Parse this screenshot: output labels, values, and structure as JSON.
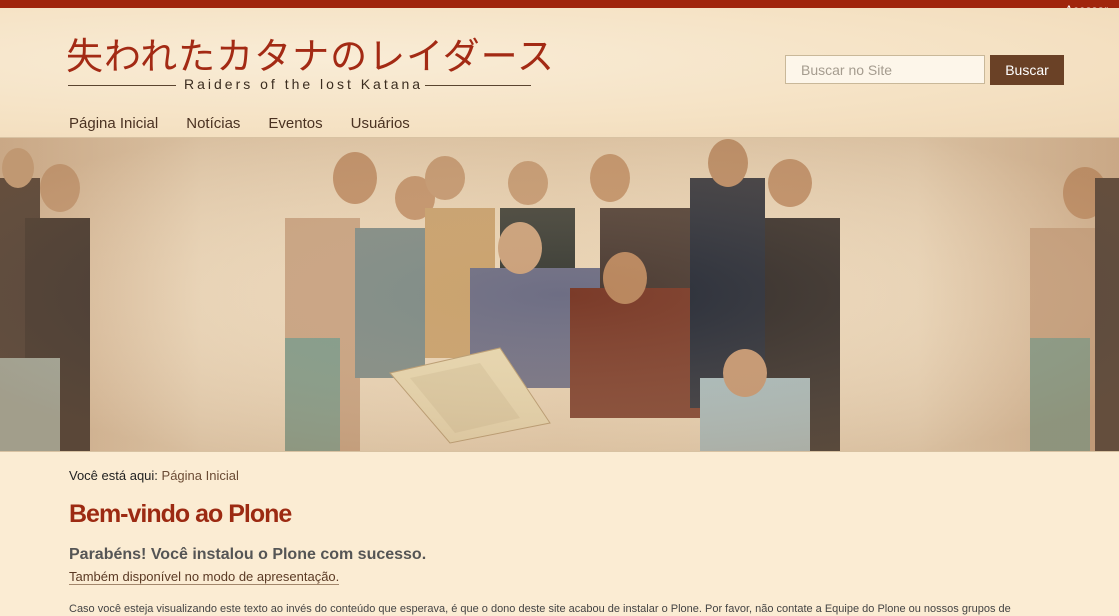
{
  "header": {
    "login_label": "Acessar",
    "logo_japanese": "失われたカタナのレイダース",
    "logo_english": "Raiders of the lost Katana"
  },
  "search": {
    "placeholder": "Buscar no Site",
    "button_label": "Buscar"
  },
  "nav": {
    "items": [
      {
        "label": "Página Inicial"
      },
      {
        "label": "Notícias"
      },
      {
        "label": "Eventos"
      },
      {
        "label": "Usuários"
      }
    ]
  },
  "breadcrumb": {
    "prefix": "Você está aqui:",
    "current": "Página Inicial"
  },
  "content": {
    "title": "Bem-vindo ao Plone",
    "subtitle": "Parabéns! Você instalou o Plone com sucesso.",
    "presentation_link": "Também disponível no modo de apresentação.",
    "body_text": "Caso você esteja visualizando este texto ao invés do conteúdo que esperava, é que o dono deste site acabou de instalar o Plone. Por favor, não contate a Equipe do Plone ou nossos grupos de"
  },
  "colors": {
    "accent": "#a0250c",
    "title": "#9c2a12",
    "button": "#6a4126",
    "background": "#fbecd3"
  }
}
